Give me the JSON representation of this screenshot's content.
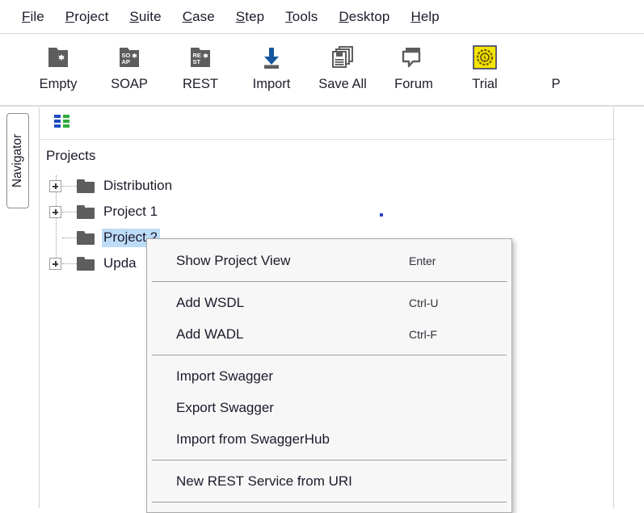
{
  "menubar": {
    "items": [
      {
        "pre": "",
        "mnemonic": "F",
        "post": "ile",
        "name": "menu-file"
      },
      {
        "pre": "",
        "mnemonic": "P",
        "post": "roject",
        "name": "menu-project"
      },
      {
        "pre": "",
        "mnemonic": "S",
        "post": "uite",
        "name": "menu-suite"
      },
      {
        "pre": "",
        "mnemonic": "C",
        "post": "ase",
        "name": "menu-case"
      },
      {
        "pre": "",
        "mnemonic": "S",
        "post": "tep",
        "name": "menu-step"
      },
      {
        "pre": "",
        "mnemonic": "T",
        "post": "ools",
        "name": "menu-tools"
      },
      {
        "pre": "",
        "mnemonic": "D",
        "post": "esktop",
        "name": "menu-desktop"
      },
      {
        "pre": "",
        "mnemonic": "H",
        "post": "elp",
        "name": "menu-help"
      }
    ]
  },
  "toolbar": {
    "buttons": [
      {
        "label": "Empty",
        "icon": "empty-project-icon"
      },
      {
        "label": "SOAP",
        "icon": "soap-project-icon"
      },
      {
        "label": "REST",
        "icon": "rest-project-icon"
      },
      {
        "label": "Import",
        "icon": "import-icon"
      },
      {
        "label": "Save All",
        "icon": "save-all-icon"
      },
      {
        "label": "Forum",
        "icon": "forum-icon"
      },
      {
        "label": "Trial",
        "icon": "trial-badge-icon"
      },
      {
        "label": "P",
        "icon": "preferences-icon"
      }
    ]
  },
  "navigator": {
    "tab_label": "Navigator",
    "toolbar_icon": "properties-grid-icon",
    "tree": {
      "root_label": "Projects",
      "nodes": [
        {
          "label": "Distribution",
          "expandable": true,
          "selected": false
        },
        {
          "label": "Project 1",
          "expandable": true,
          "selected": false
        },
        {
          "label": "Project 2",
          "expandable": false,
          "selected": true
        },
        {
          "label": "Upda",
          "expandable": true,
          "selected": false
        }
      ]
    }
  },
  "context_menu": {
    "items": [
      {
        "type": "item",
        "label": "Show Project View",
        "accel": "Enter"
      },
      {
        "type": "separator"
      },
      {
        "type": "item",
        "label": "Add WSDL",
        "accel": "Ctrl-U"
      },
      {
        "type": "item",
        "label": "Add WADL",
        "accel": "Ctrl-F"
      },
      {
        "type": "separator"
      },
      {
        "type": "item",
        "label": "Import Swagger",
        "accel": ""
      },
      {
        "type": "item",
        "label": "Export Swagger",
        "accel": ""
      },
      {
        "type": "item",
        "label": "Import from SwaggerHub",
        "accel": ""
      },
      {
        "type": "separator"
      },
      {
        "type": "item",
        "label": "New REST Service from URI",
        "accel": ""
      },
      {
        "type": "separator"
      }
    ]
  },
  "colors": {
    "selection": "#bcdcf7",
    "trial_yellow": "#f6e500",
    "import_blue": "#14579e",
    "icon_gray": "#5d5d5d",
    "grid_blue": "#1f4fc4",
    "grid_green": "#2faa3c"
  }
}
